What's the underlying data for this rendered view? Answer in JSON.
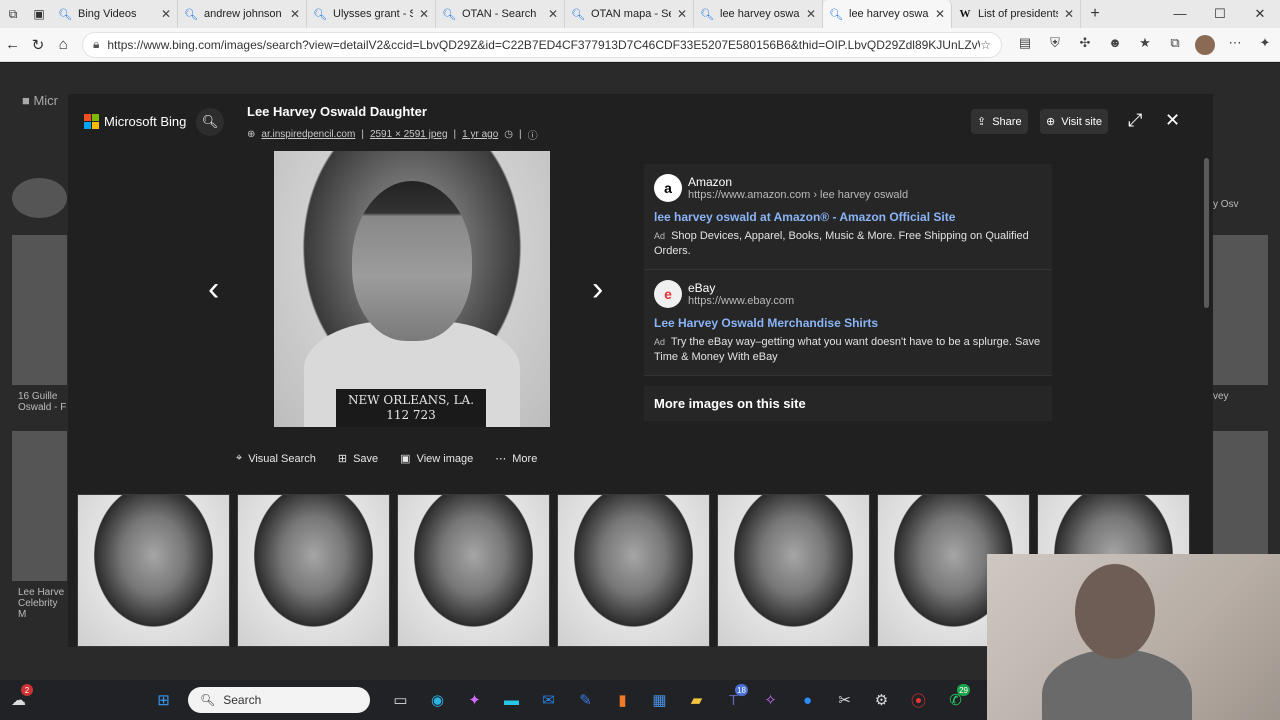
{
  "tabs": [
    {
      "title": "Bing Videos",
      "icon": "search-icon"
    },
    {
      "title": "andrew johnson - Se",
      "icon": "search-icon"
    },
    {
      "title": "Ulysses grant - Sea",
      "icon": "search-icon"
    },
    {
      "title": "OTAN - Search",
      "icon": "search-icon"
    },
    {
      "title": "OTAN mapa - Searc",
      "icon": "search-icon"
    },
    {
      "title": "lee harvey oswald",
      "icon": "search-icon"
    },
    {
      "title": "lee harvey oswald",
      "icon": "search-icon"
    },
    {
      "title": "List of presidents",
      "icon": "wikipedia-icon"
    }
  ],
  "address": {
    "url": "https://www.bing.com/images/search?view=detailV2&ccid=LbvQD29Z&id=C22B7ED4CF377913D7C46CDF33E5207E580156B6&thid=OIP.LbvQD29Zdl89KJUnLZvWpQ..."
  },
  "modal": {
    "brand": "Microsoft Bing",
    "title": "Lee Harvey Oswald Daughter",
    "meta_site": "ar.inspiredpencil.com",
    "meta_size": "2591 × 2591 jpeg",
    "meta_age": "1 yr ago",
    "share_label": "Share",
    "visit_label": "Visit site",
    "image_plate_line1": "NEW ORLEANS, LA.",
    "image_plate_line2": "112 723",
    "actions": {
      "visual_search": "Visual Search",
      "save": "Save",
      "view_image": "View image",
      "more": "More"
    },
    "ads": [
      {
        "logo": "a",
        "name": "Amazon",
        "url": "https://www.amazon.com › lee harvey oswald",
        "title": "lee harvey oswald at Amazon® - Amazon Official Site",
        "tag": "Ad",
        "desc": "Shop Devices, Apparel, Books, Music & More. Free Shipping on Qualified Orders."
      },
      {
        "logo": "e",
        "name": "eBay",
        "url": "https://www.ebay.com",
        "title": "Lee Harvey Oswald Merchandise Shirts",
        "tag": "Ad",
        "desc": "Try the eBay way–getting what you want doesn't have to be a splurge. Save Time & Money With eBay"
      }
    ],
    "more_images": "More images on this site"
  },
  "background": {
    "label_left_1": "16 Guille Oswald - F",
    "label_left_2": "Lee Harve Celebrity M",
    "label_right": "vey",
    "label_right_top": "y Osv"
  },
  "taskbar": {
    "search_placeholder": "Search",
    "badges": {
      "start": "2",
      "teams": "18",
      "whatsapp": "29"
    }
  }
}
